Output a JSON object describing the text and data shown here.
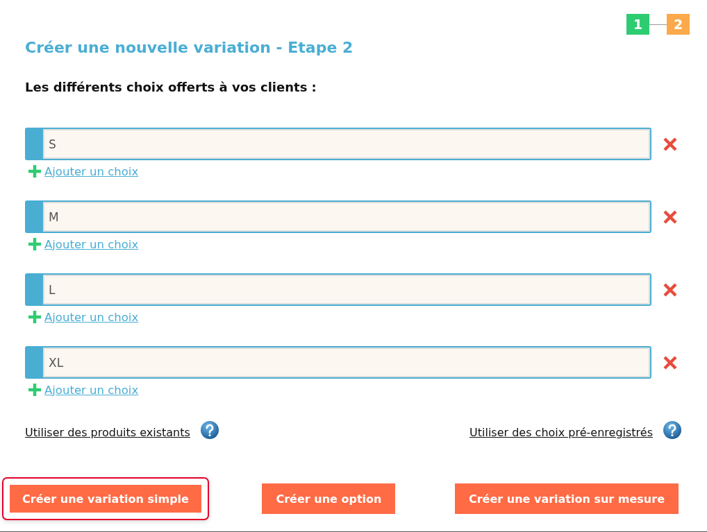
{
  "steps": [
    {
      "label": "1",
      "selected": false
    },
    {
      "label": "2",
      "selected": true
    }
  ],
  "title": "Créer une nouvelle variation - Etape 2",
  "subtitle": "Les différents choix offerts à vos clients :",
  "choices": [
    {
      "value": "S",
      "add_label": "Ajouter un choix"
    },
    {
      "value": "M",
      "add_label": "Ajouter un choix"
    },
    {
      "value": "L",
      "add_label": "Ajouter un choix"
    },
    {
      "value": "XL",
      "add_label": "Ajouter un choix"
    }
  ],
  "links": [
    {
      "label": "Utiliser des produits existants"
    },
    {
      "label": "Utiliser des choix pré-enregistrés"
    }
  ],
  "buttons": [
    {
      "label": "Créer une variation simple",
      "selected": true
    },
    {
      "label": "Créer une option",
      "selected": false
    },
    {
      "label": "Créer une variation sur mesure",
      "selected": false
    }
  ]
}
